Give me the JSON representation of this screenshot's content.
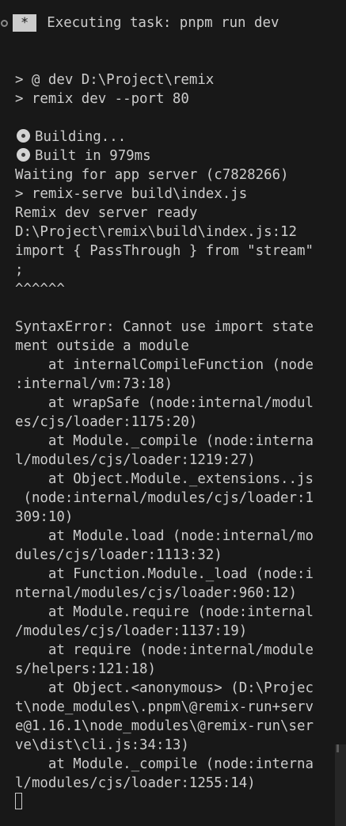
{
  "task": {
    "star": "*",
    "title": "Executing task: pnpm run dev"
  },
  "lines": [
    "> @ dev D:\\Project\\remix",
    "> remix dev --port 80",
    "",
    "Building...",
    "Built in 979ms",
    "Waiting for app server (c7828266)",
    "> remix-serve build\\index.js",
    "Remix dev server ready",
    "D:\\Project\\remix\\build\\index.js:12",
    "import { PassThrough } from \"stream\"",
    ";",
    "^^^^^^",
    "",
    "SyntaxError: Cannot use import state",
    "ment outside a module",
    "    at internalCompileFunction (node",
    ":internal/vm:73:18)",
    "    at wrapSafe (node:internal/modul",
    "es/cjs/loader:1175:20)",
    "    at Module._compile (node:interna",
    "l/modules/cjs/loader:1219:27)",
    "    at Object.Module._extensions..js",
    " (node:internal/modules/cjs/loader:1",
    "309:10)",
    "    at Module.load (node:internal/mo",
    "dules/cjs/loader:1113:32)",
    "    at Function.Module._load (node:i",
    "nternal/modules/cjs/loader:960:12)",
    "    at Module.require (node:internal",
    "/modules/cjs/loader:1137:19)",
    "    at require (node:internal/module",
    "s/helpers:121:18)",
    "    at Object.<anonymous> (D:\\Projec",
    "t\\node_modules\\.pnpm\\@remix-run+serv",
    "e@1.16.1\\node_modules\\@remix-run\\ser",
    "ve\\dist\\cli.js:34:13)",
    "    at Module._compile (node:interna",
    "l/modules/cjs/loader:1255:14)"
  ],
  "icons": {
    "building_line_icon": "disc-icon",
    "built_line_icon": "disc-icon"
  },
  "colors": {
    "background": "#181818",
    "foreground": "#cccccc"
  }
}
